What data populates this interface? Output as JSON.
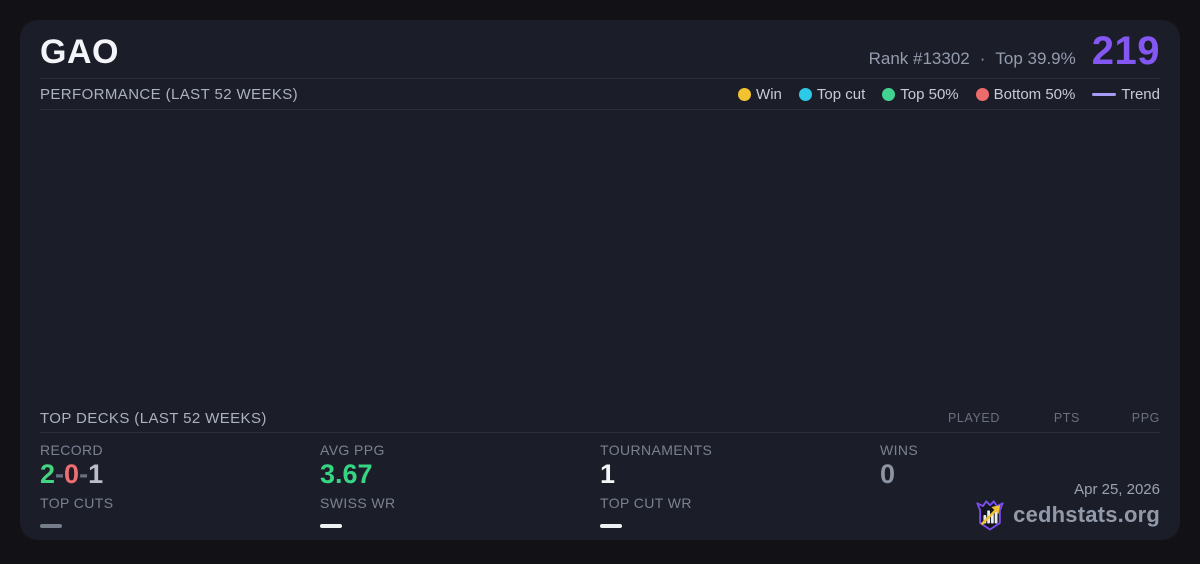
{
  "card": {
    "player_name": "GAO",
    "rank_text": "Rank #13302",
    "separator": "·",
    "percentile_text": "Top 39.9%",
    "score": "219",
    "accent_color": "#8457f2"
  },
  "performance": {
    "title": "PERFORMANCE (LAST 52 WEEKS)",
    "legend": [
      {
        "label": "Win",
        "color": "#f2c230",
        "type": "dot"
      },
      {
        "label": "Top cut",
        "color": "#2cc9e8",
        "type": "dot"
      },
      {
        "label": "Top 50%",
        "color": "#42d392",
        "type": "dot"
      },
      {
        "label": "Bottom 50%",
        "color": "#ee6b6b",
        "type": "dot"
      },
      {
        "label": "Trend",
        "color": "#a79bf5",
        "type": "line"
      }
    ],
    "chart_points": []
  },
  "top_decks": {
    "title": "TOP DECKS (LAST 52 WEEKS)",
    "columns": [
      "PLAYED",
      "PTS",
      "PPG"
    ],
    "rows": []
  },
  "stats": {
    "record": {
      "label": "RECORD",
      "wins": "2",
      "losses": "0",
      "draws": "1",
      "sep": "-",
      "wins_color": "#44d37f",
      "losses_color": "#ef6e73",
      "draws_color": "#b9bfca"
    },
    "avg_ppg": {
      "label": "AVG PPG",
      "value": "3.67",
      "value_color": "#35d583"
    },
    "tournaments": {
      "label": "TOURNAMENTS",
      "value": "1"
    },
    "wins": {
      "label": "WINS",
      "value": "0"
    },
    "top_cuts": {
      "label": "TOP CUTS"
    },
    "swiss_wr": {
      "label": "SWISS WR"
    },
    "top_cut_wr": {
      "label": "TOP CUT WR"
    }
  },
  "footer": {
    "date": "Apr 25, 2026",
    "brand": "cedhstats.org"
  }
}
